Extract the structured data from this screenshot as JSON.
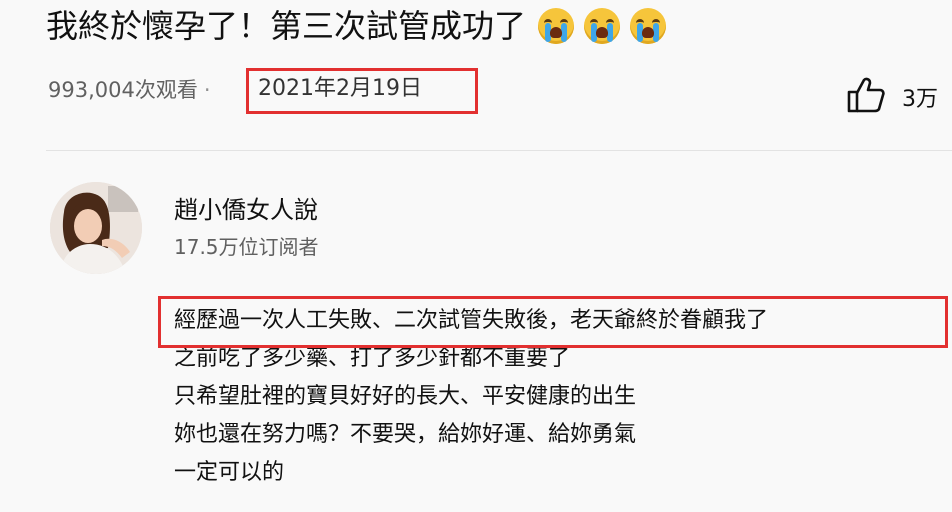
{
  "video": {
    "title": "我終於懷孕了！第三次試管成功了",
    "title_emojis": [
      "loudly-crying-face",
      "loudly-crying-face",
      "loudly-crying-face"
    ],
    "views": "993,004次观看",
    "date": "2021年2月19日",
    "likes": "3万"
  },
  "channel": {
    "name": "趙小僑女人說",
    "subscribers": "17.5万位订阅者"
  },
  "description": {
    "lines": [
      "經歷過一次人工失敗、二次試管失敗後，老天爺終於眷顧我了",
      "之前吃了多少藥、打了多少針都不重要了",
      "只希望肚裡的寶貝好好的長大、平安健康的出生",
      "妳也還在努力嗎？不要哭，給妳好運、給妳勇氣",
      "一定可以的"
    ]
  },
  "highlight_color": "#e23030"
}
